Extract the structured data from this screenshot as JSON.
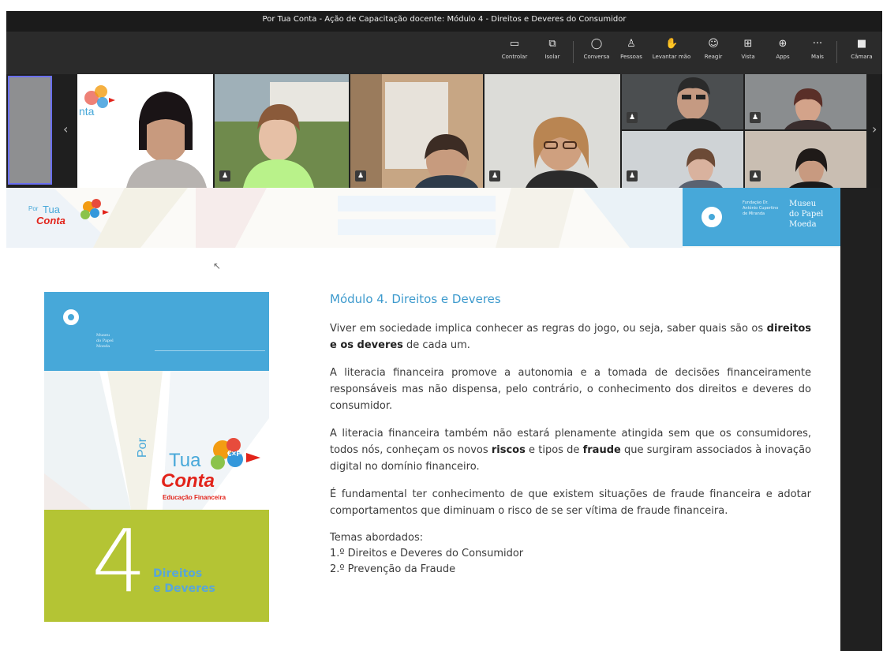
{
  "window": {
    "title": "Por Tua Conta - Ação de Capacitação docente: Módulo 4 - Direitos e Deveres do Consumidor"
  },
  "toolbar": {
    "items": [
      {
        "label": "Controlar",
        "icon": "control-icon"
      },
      {
        "label": "Isolar",
        "icon": "pop-out-icon"
      },
      {
        "label": "Conversa",
        "icon": "chat-icon"
      },
      {
        "label": "Pessoas",
        "icon": "people-icon"
      },
      {
        "label": "Levantar mão",
        "icon": "raise-hand-icon"
      },
      {
        "label": "Reagir",
        "icon": "react-icon"
      },
      {
        "label": "Vista",
        "icon": "view-icon"
      },
      {
        "label": "Apps",
        "icon": "apps-icon"
      },
      {
        "label": "Mais",
        "icon": "more-icon"
      },
      {
        "label": "Câmara",
        "icon": "camera-icon"
      }
    ]
  },
  "participants": {
    "count": 10
  },
  "slide": {
    "header_logo": {
      "line1": "Tua",
      "line2": "Conta",
      "prefix": "Por"
    },
    "museum": {
      "foundation": "Fundação Dr. António Cupertino de Miranda",
      "name_line1": "Museu",
      "name_line2": "do Papel",
      "name_line3": "Moeda"
    },
    "book": {
      "museum_line1": "Museu",
      "museum_line2": "do Papel",
      "museum_line3": "Moeda",
      "logo_prefix": "Por",
      "logo_line1": "Tua",
      "logo_line2": "Conta",
      "logo_badge": "€×F",
      "logo_subtitle": "Educação Financeira",
      "module_number": "4",
      "module_title_line1": "Direitos",
      "module_title_line2": "e Deveres"
    },
    "heading": "Módulo 4. Direitos e Deveres",
    "p1_a": "Viver em sociedade implica conhecer as regras do jogo, ou seja, saber quais são os ",
    "p1_b": "direitos e os deveres",
    "p1_c": " de cada um.",
    "p2": "A literacia financeira promove a autonomia e a tomada de decisões financeiramente responsáveis mas não dispensa, pelo contrário, o conhecimento dos direitos e deveres do consumidor.",
    "p3_a": "A literacia financeira também não estará plenamente atingida sem que os consumidores, todos nós, conheçam os novos ",
    "p3_b": "riscos",
    "p3_c": " e tipos de ",
    "p3_d": "fraude",
    "p3_e": " que surgiram associados à inovação digital no domínio financeiro.",
    "p4": "É fundamental ter conhecimento de que existem situações de fraude financeira e adotar comportamentos que diminuam o risco de se ser vítima de fraude financeira.",
    "topics_title": "Temas abordados:",
    "topic1": "1.º Direitos e Deveres do Consumidor",
    "topic2": "2.º Prevenção da Fraude"
  },
  "colors": {
    "accent_blue": "#47a8d9",
    "lime": "#b4c434",
    "logo_red": "#e2231a"
  }
}
